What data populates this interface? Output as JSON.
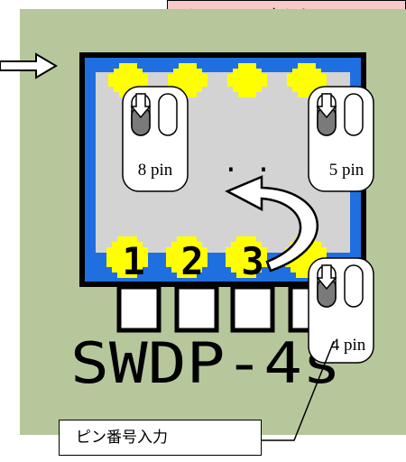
{
  "callout_text": "と、ドリル穴として",
  "input_label": "ピン番号入力",
  "pin_labels": {
    "top_left": "8 pin",
    "top_right": "5 pin",
    "bottom_right": "4 pin"
  },
  "pad_numbers": [
    "1",
    "2",
    "3"
  ],
  "dots": ". .",
  "part_name": "SWDP-4s",
  "colors": {
    "board": "#b7c79c",
    "chip_frame": "#1f6fe0",
    "chip_body": "#d3d3d3",
    "pad": "#ffff00",
    "callout_fill": "#f8c9c9"
  }
}
